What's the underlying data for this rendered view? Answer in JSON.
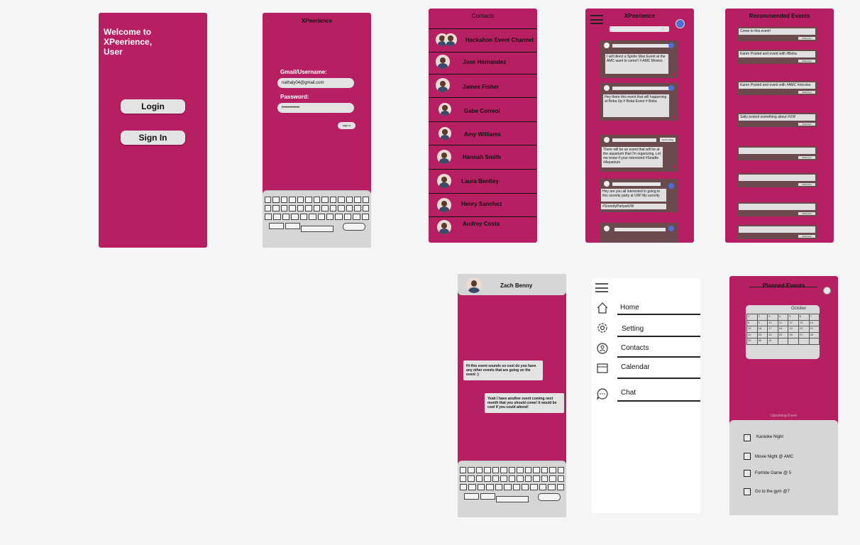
{
  "welcome": {
    "title": "Welcome to XPeerience, User",
    "login_label": "Login",
    "signin_label": "Sign In"
  },
  "signin": {
    "title": "XPeerience",
    "user_label": "Gmail/Username:",
    "user_value": "nathaly04@gmail.com",
    "pass_label": "Password:",
    "pass_value": "••••••••••••",
    "submit_label": "sign in"
  },
  "contacts": {
    "title": "Contacts",
    "items": [
      "Hackahon Event Channel",
      "Jose Hernandez",
      "James Fisher",
      "Gabe Correoi",
      "Amy Williams",
      "Hannah Smith",
      "Laura Bentley",
      "Henry Sanchez",
      "Audrey Costa"
    ]
  },
  "feed": {
    "title": "XPeerience",
    "posts": [
      "I will direct a Spider Man Event at the AMC want to come!! # AMC Movies",
      "Hey there this event that will happening at Boba Up # Boba Event # Boba",
      "There will be an event that will be at the aquarium that I'm organizing. Let me know if your interested #Seattle #Aquarium",
      "Hey are you all interested in going to this sorority party at UW! My sorority",
      "#SororityPartyatUW"
    ],
    "join_label": "Send a Msg"
  },
  "recommended": {
    "title": "Recommended Events",
    "items": [
      "Come to this event!",
      "Karen Posted and event with #Boba",
      "Karen Posted and event with #AMC #movies",
      "Sally posted something about #UW",
      "",
      "",
      "",
      ""
    ],
    "tag_label": "Click here"
  },
  "chat": {
    "name": "Zach Benny",
    "msg1": "Hi this event sounds so cool do you have any other events that are going on the event :)",
    "msg2": "Yeah I have another event coming next month that you should come! It would be cool if you could attend!"
  },
  "menu": {
    "items": [
      "Home",
      "Setting",
      "Contacts",
      "Calendar",
      "Chat"
    ]
  },
  "planned": {
    "title": "Planned Events",
    "month": "October",
    "upcoming_label": "Upcoming Event",
    "events": [
      "Karaoke Night",
      "Movie Night @ AMC",
      "Fortnite Game @ 5",
      "Go to the gym @7"
    ],
    "days": [
      "1",
      "2",
      "3",
      "4",
      "5",
      "6",
      "7",
      "8",
      "9",
      "10",
      "11",
      "12",
      "13",
      "14",
      "15",
      "16",
      "17",
      "18",
      "19",
      "20",
      "21",
      "22",
      "23",
      "24",
      "25",
      "26",
      "27",
      "28",
      "29",
      "30",
      "31"
    ]
  }
}
